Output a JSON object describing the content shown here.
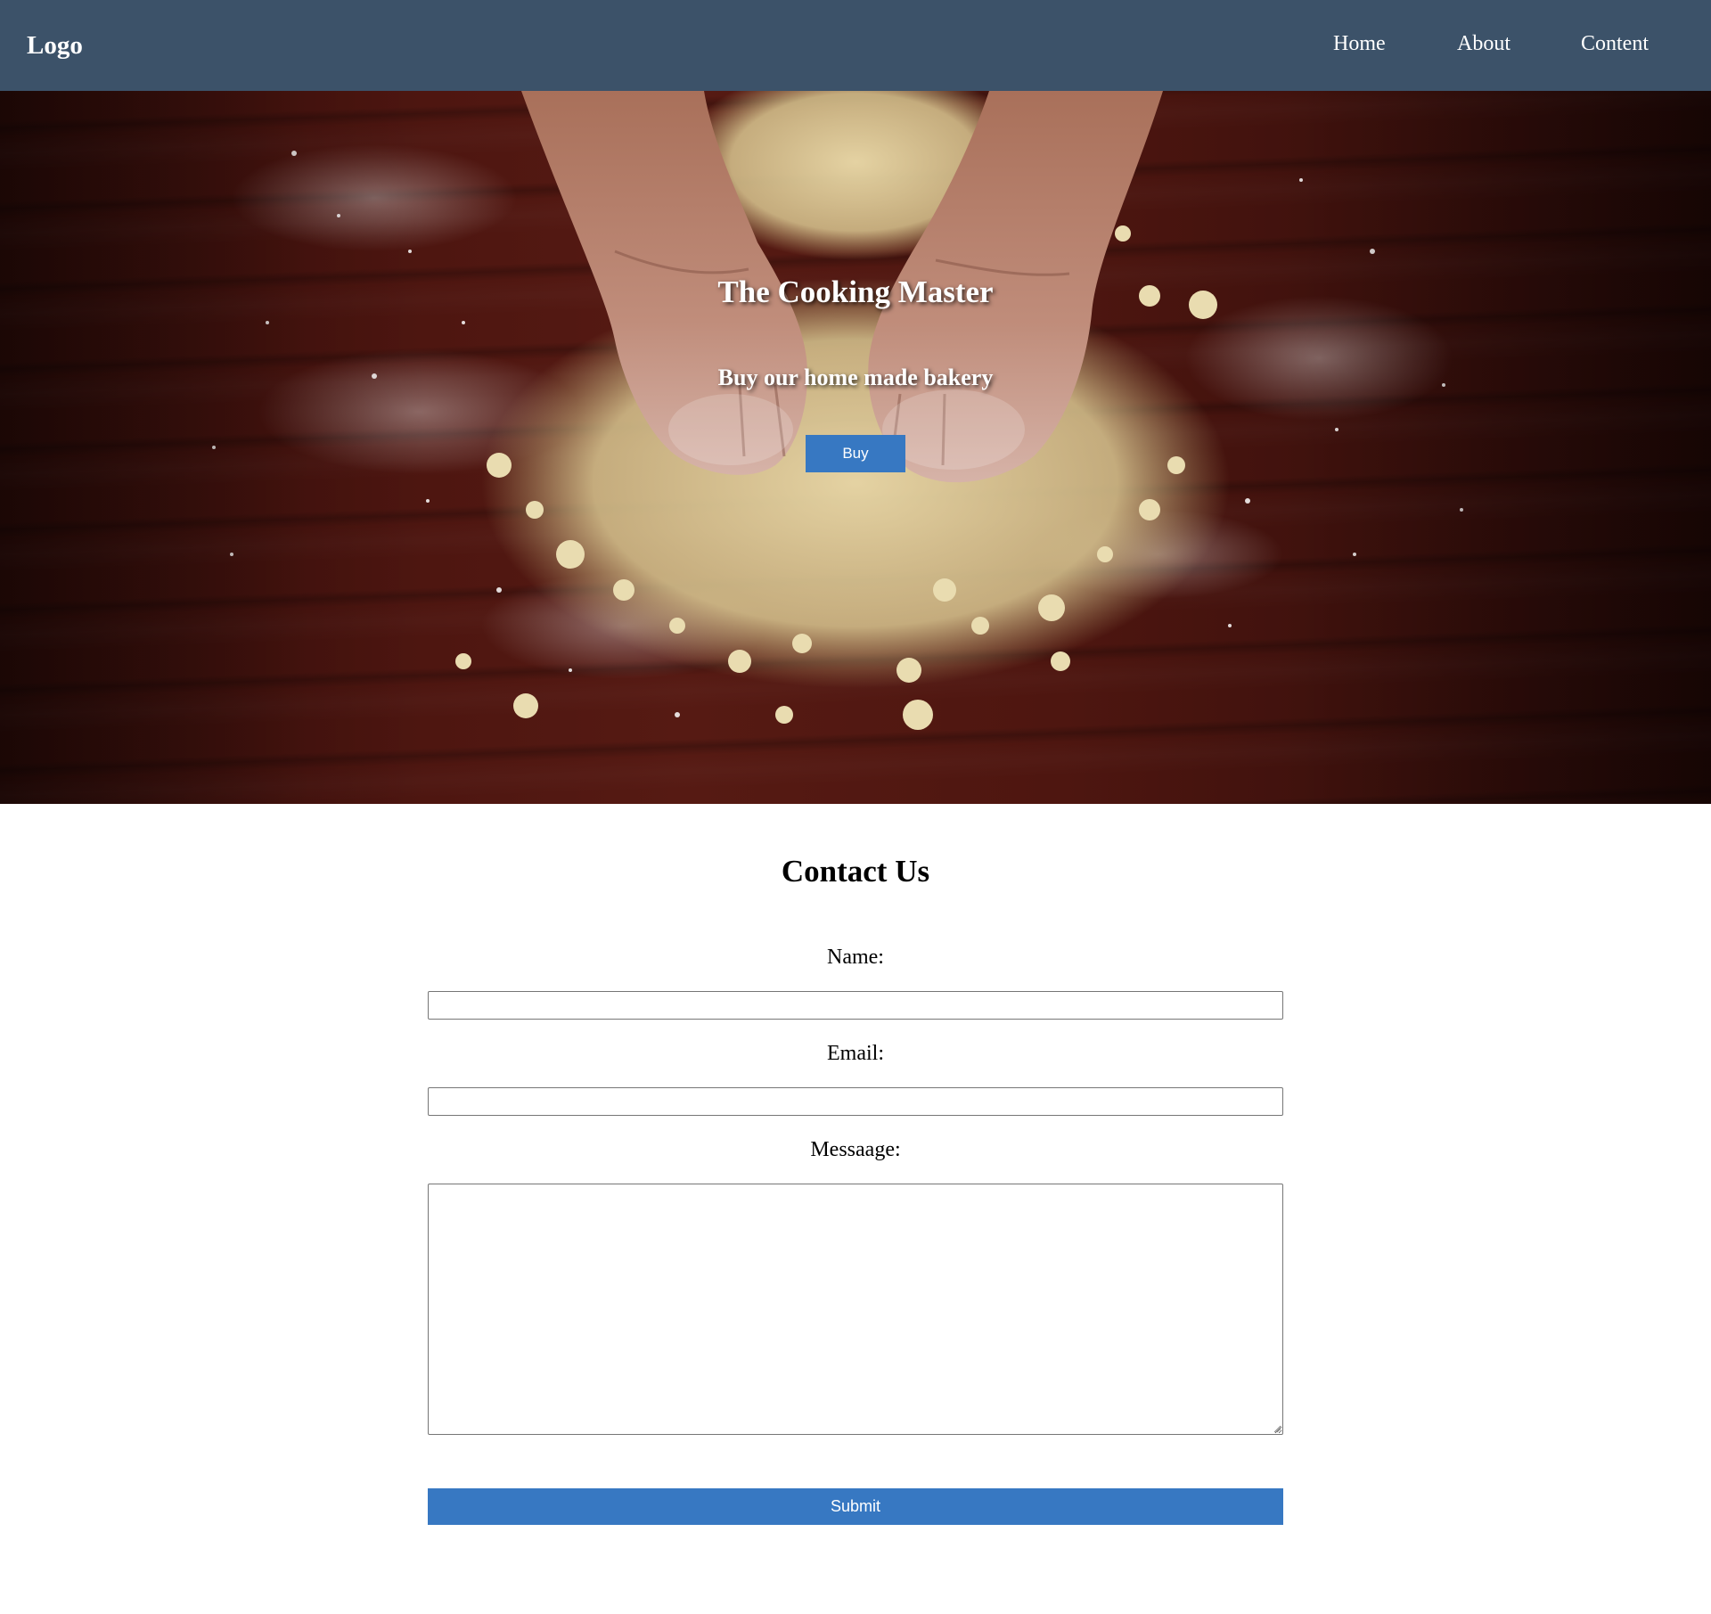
{
  "navbar": {
    "logo": "Logo",
    "links": [
      "Home",
      "About",
      "Content"
    ],
    "background_color": "#3c5269"
  },
  "hero": {
    "title": "The Cooking Master",
    "subtitle": "Buy our home made bakery",
    "buy_label": "Buy",
    "background_image": "hands kneading crumbly dough on dark wooden table with scattered flour",
    "button_color": "#3778c2"
  },
  "contact": {
    "title": "Contact Us",
    "name_label": "Name:",
    "name_value": "",
    "email_label": "Email:",
    "email_value": "",
    "message_label": "Messaage:",
    "message_value": "",
    "submit_label": "Submit",
    "button_color": "#3778c2"
  }
}
